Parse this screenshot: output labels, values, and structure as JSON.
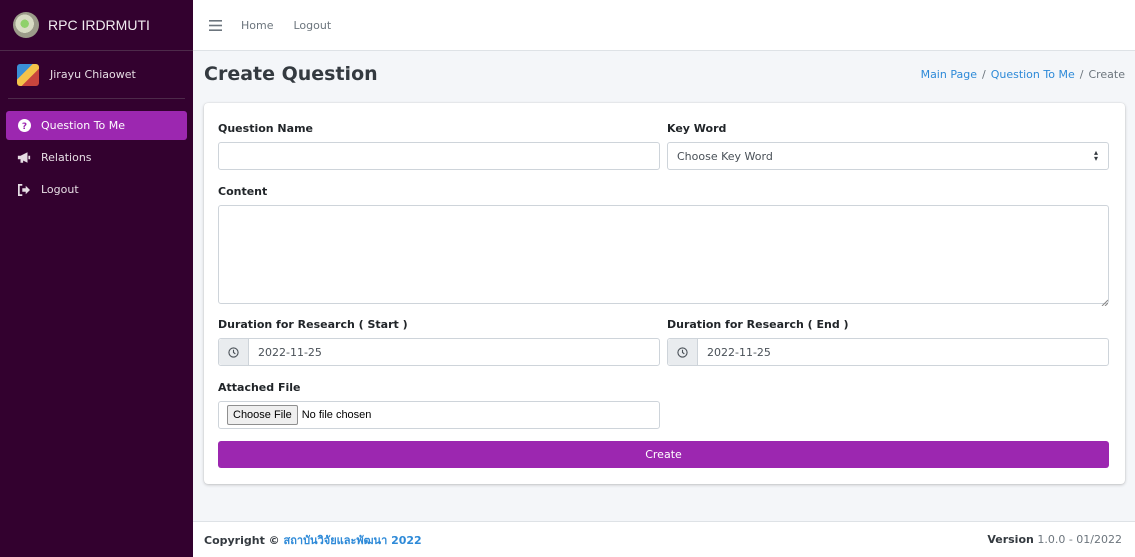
{
  "brand": {
    "name": "RPC IRDRMUTI"
  },
  "user": {
    "name": "Jirayu Chiaowet"
  },
  "sidebar": {
    "items": [
      {
        "label": "Question To Me",
        "icon": "question-circle-icon",
        "active": true
      },
      {
        "label": "Relations",
        "icon": "bullhorn-icon",
        "active": false
      },
      {
        "label": "Logout",
        "icon": "sign-out-icon",
        "active": false
      }
    ]
  },
  "topbar": {
    "home": "Home",
    "logout": "Logout"
  },
  "page": {
    "title": "Create Question"
  },
  "breadcrumb": {
    "items": [
      "Main Page",
      "Question To Me",
      "Create"
    ],
    "separator": "/"
  },
  "form": {
    "question_name": {
      "label": "Question Name",
      "value": ""
    },
    "keyword": {
      "label": "Key Word",
      "value": "Choose Key Word"
    },
    "content": {
      "label": "Content",
      "value": ""
    },
    "start": {
      "label": "Duration for Research ( Start )",
      "value": "2022-11-25"
    },
    "end": {
      "label": "Duration for Research ( End )",
      "value": "2022-11-25"
    },
    "file": {
      "label": "Attached File",
      "button": "Choose File",
      "status": "No file chosen"
    },
    "submit": "Create"
  },
  "footer": {
    "copyright": "Copyright ©",
    "org": "สถาบันวิจัยและพัฒนา 2022",
    "version_label": "Version",
    "version_value": "1.0.0 - 01/2022"
  },
  "colors": {
    "sidebar": "#33012f",
    "accent": "#9c27b0",
    "link": "#2e8ad8"
  }
}
